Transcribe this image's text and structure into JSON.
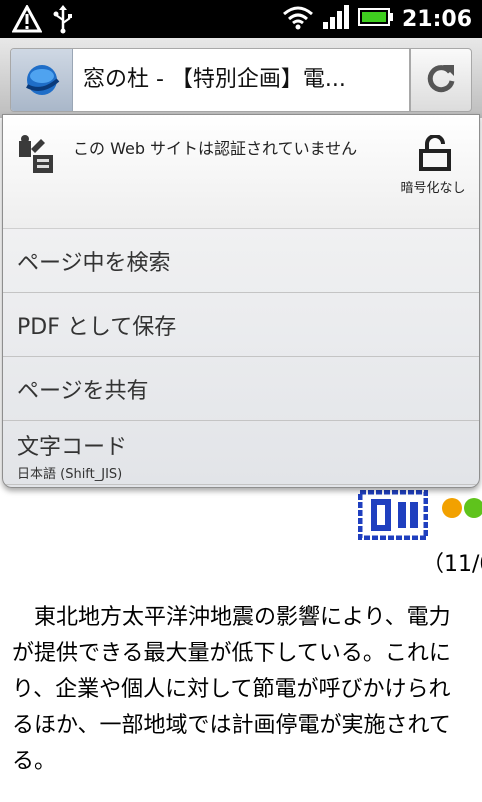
{
  "status_bar": {
    "time": "21:06",
    "icons": [
      "alert-triangle-icon",
      "usb-icon",
      "wifi-icon",
      "signal-icon",
      "battery-icon"
    ]
  },
  "browser": {
    "page_title": "窓の杜 - 【特別企画】電...",
    "favicon": "globe-icon",
    "reload_icon": "refresh-icon"
  },
  "menu": {
    "certificate_message": "この Web サイトは認証されていません",
    "lock_label": "暗号化なし",
    "items": [
      {
        "label": "ページ中を検索"
      },
      {
        "label": "PDF として保存"
      },
      {
        "label": "ページを共有"
      },
      {
        "label": "文字コード",
        "sublabel": "日本語 (Shift_JIS)"
      }
    ]
  },
  "page": {
    "date_fragment": "（11/0",
    "lines": [
      "　東北地方太平洋沖地震の影響により、電力",
      "が提供できる最大量が低下している。これに",
      "り、企業や個人に対して節電が呼びかけられ",
      "るほか、一部地域では計画停電が実施されて",
      "る。"
    ]
  },
  "colors": {
    "status_bar_bg": "#000000",
    "battery_green": "#3fcf1f",
    "chrome_bg": "#cfcfcf",
    "logo_blue": "#1f3fbf",
    "logo_orange": "#f2a100"
  }
}
